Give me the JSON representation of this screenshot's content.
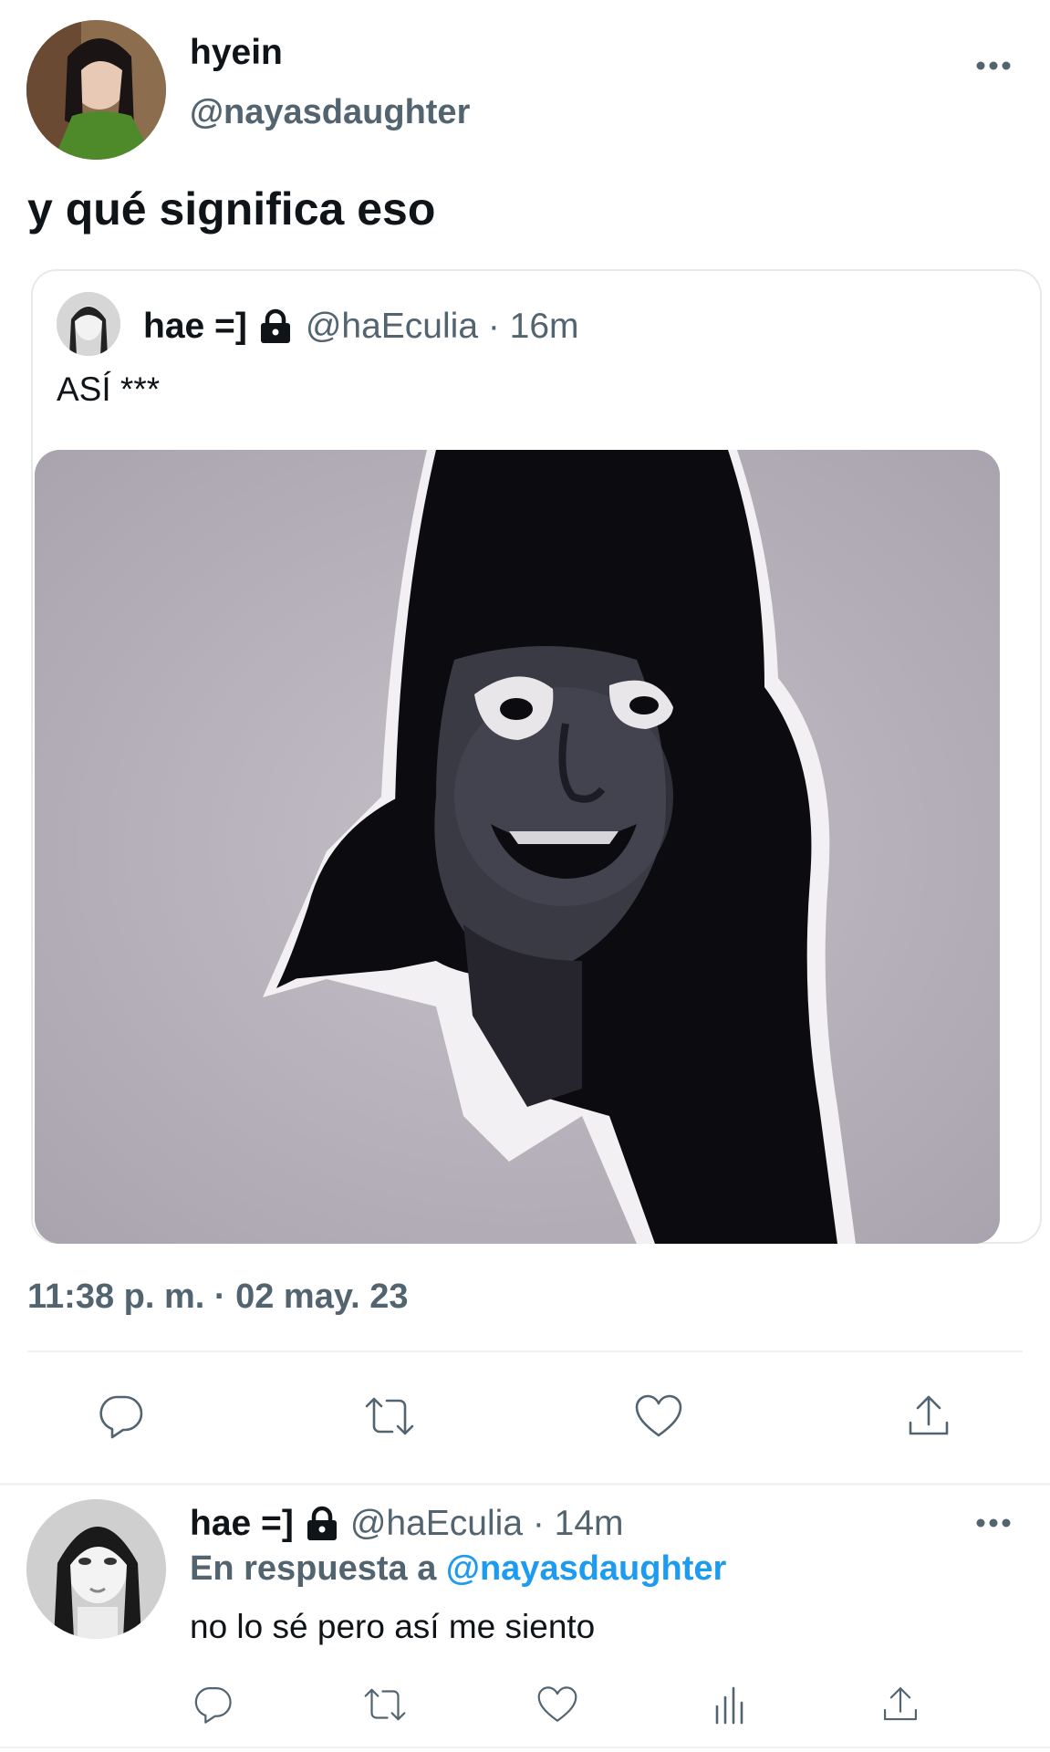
{
  "tweet": {
    "author": {
      "name": "hyein",
      "handle": "@nayasdaughter"
    },
    "text": "y qué significa eso",
    "timestamp": "11:38 p. m. · 02 may. 23",
    "more_icon": "more-horizontal-icon"
  },
  "quote": {
    "author": {
      "name": "hae =]",
      "handle": "@haEculia · 16m",
      "lock_icon": "lock-icon"
    },
    "text": "ASÍ ***",
    "media_icon": "photo"
  },
  "actions": [
    "reply-icon",
    "retweet-icon",
    "like-icon",
    "share-icon"
  ],
  "reply": {
    "author": {
      "name": "hae =]",
      "handle": "@haEculia · 14m",
      "lock_icon": "lock-icon"
    },
    "replying_prefix": "En respuesta a",
    "replying_handle": "@nayasdaughter",
    "text": "no lo sé pero así me siento",
    "actions": [
      "reply-icon",
      "retweet-icon",
      "like-icon",
      "analytics-icon",
      "share-icon"
    ]
  },
  "colors": {
    "accent": "#1d9bf0",
    "muted": "#536471",
    "border": "#e7e9ea"
  }
}
